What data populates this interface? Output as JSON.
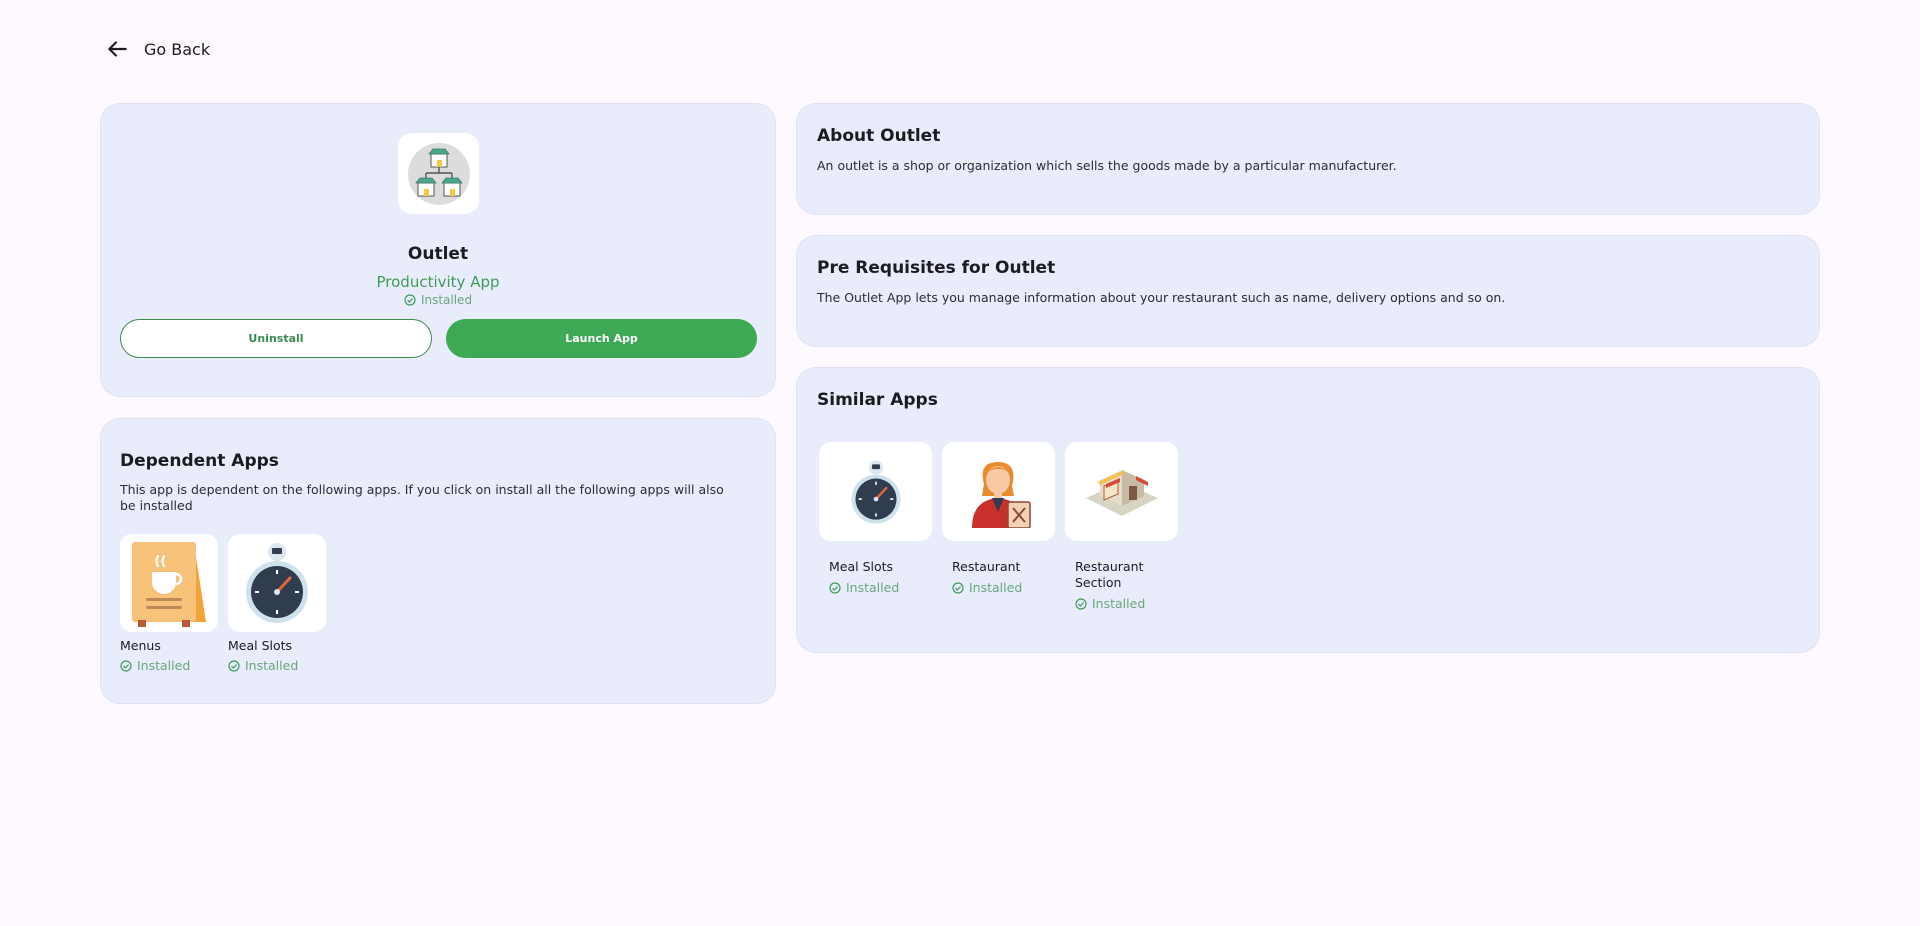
{
  "nav": {
    "back_label": "Go Back"
  },
  "app": {
    "name": "Outlet",
    "category": "Productivity App",
    "status": "Installed",
    "uninstall_label": "Uninstall",
    "launch_label": "Launch App",
    "icon": "outlet-icon"
  },
  "dependent": {
    "title": "Dependent Apps",
    "description": "This app is dependent on the following apps. If you click on install all the following apps will also be installed",
    "apps": [
      {
        "name": "Menus",
        "status": "Installed",
        "icon": "menu-board-icon"
      },
      {
        "name": "Meal Slots",
        "status": "Installed",
        "icon": "stopwatch-icon"
      }
    ]
  },
  "about": {
    "title": "About Outlet",
    "text": "An outlet is a shop or organization which sells the goods made by a particular manufacturer."
  },
  "prereq": {
    "title": "Pre Requisites for Outlet",
    "text": "The Outlet App lets you manage information about your restaurant such as name, delivery options and so on."
  },
  "similar": {
    "title": "Similar Apps",
    "apps": [
      {
        "name": "Meal Slots",
        "status": "Installed",
        "icon": "stopwatch-icon"
      },
      {
        "name": "Restaurant",
        "status": "Installed",
        "icon": "restaurant-staff-icon"
      },
      {
        "name": "Restaurant Section",
        "status": "Installed",
        "icon": "restaurant-building-icon"
      }
    ]
  },
  "colors": {
    "background": "#fdf9fe",
    "card": "#e9edfb",
    "accent_green": "#3da954",
    "status_green": "#6aa67b"
  }
}
